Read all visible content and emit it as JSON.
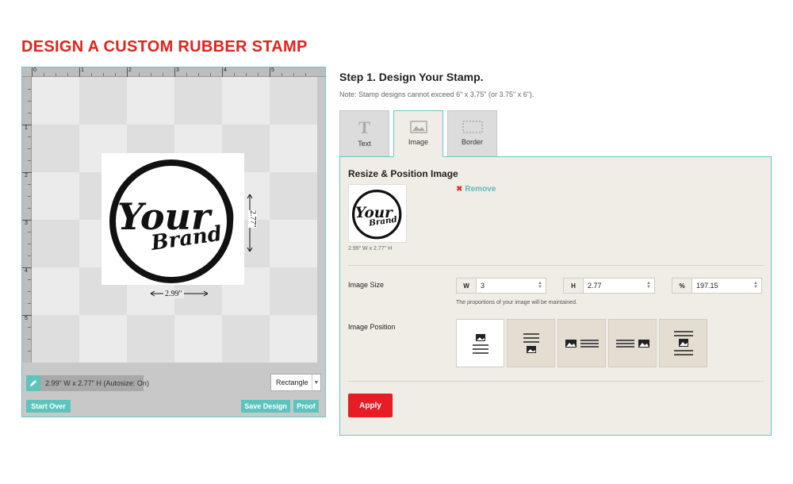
{
  "page": {
    "title": "DESIGN A CUSTOM RUBBER STAMP"
  },
  "designer": {
    "ruler_top_numbers": [
      "0",
      "1",
      "2",
      "3",
      "4",
      "5"
    ],
    "ruler_left_numbers": [
      "1",
      "2",
      "3",
      "4",
      "5"
    ],
    "stamp_logo": {
      "word1": "Your",
      "word2": "Brand"
    },
    "dimension_width": "2.99\"",
    "dimension_height": "2.77\"",
    "size_readout": "2.99\" W x 2.77\" H   (Autosize: On)",
    "shape_select": "Rectangle",
    "start_over_label": "Start Over",
    "save_design_label": "Save Design",
    "proof_label": "Proof",
    "colors": {
      "accent": "#5bc4bd",
      "border": "#6cc7c7"
    }
  },
  "step": {
    "title": "Step 1. Design Your Stamp.",
    "note": "Note: Stamp designs cannot exceed 6\" x 3.75\" (or 3.75\" x 6\")."
  },
  "tabs": [
    {
      "label": "Text",
      "icon": "text-t-icon"
    },
    {
      "label": "Image",
      "icon": "image-icon"
    },
    {
      "label": "Border",
      "icon": "border-icon"
    }
  ],
  "panel": {
    "heading": "Resize & Position Image",
    "thumb_caption": "2.99\" W x 2.77\" H",
    "remove_label": "Remove",
    "image_size_label": "Image Size",
    "width_label": "W",
    "width_value": "3",
    "height_label": "H",
    "height_value": "2.77",
    "percent_label": "%",
    "percent_value": "197.15",
    "proportion_hint": "The proportions of your image will be maintained.",
    "image_position_label": "Image Position",
    "apply_label": "Apply",
    "apply_color": "#e81c24"
  }
}
